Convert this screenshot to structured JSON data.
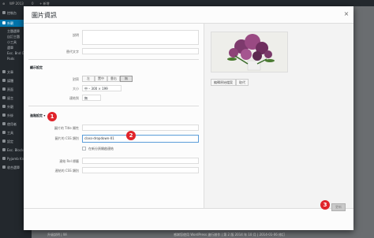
{
  "adminbar": {
    "site": "WP 2013",
    "notifications": "0",
    "new_label": "+ 新增"
  },
  "sidebar": {
    "items": [
      {
        "label": "控制台",
        "active": false
      },
      {
        "label": "外觀",
        "active": true
      },
      {
        "label": "文章",
        "active": false
      },
      {
        "label": "媒體",
        "active": false
      },
      {
        "label": "頁面",
        "active": false
      },
      {
        "label": "留言",
        "active": false
      },
      {
        "label": "外觀",
        "active": false
      },
      {
        "label": "外掛",
        "active": false
      },
      {
        "label": "使用者",
        "active": false
      },
      {
        "label": "工具",
        "active": false
      },
      {
        "label": "設定",
        "active": false
      },
      {
        "label": "Exc. Blocks",
        "active": false
      },
      {
        "label": "Pyjamb Knives",
        "active": false
      },
      {
        "label": "收合選單",
        "active": false
      }
    ],
    "subitems": [
      "主題選單",
      "自訂主題",
      "小工具",
      "選單",
      "Exc. Bnd Gallery",
      "Pods"
    ]
  },
  "modal": {
    "title": "圖片資訊",
    "close_glyph": "×",
    "fields": {
      "caption_label": "說明",
      "alt_label": "替代文字"
    },
    "display_settings": {
      "title": "顯示設定",
      "align_label": "對齊",
      "align_options": [
        "左",
        "置中",
        "靠右",
        "無"
      ],
      "align_selected": "無",
      "size_label": "大小",
      "size_value": "中 – 300 × 199",
      "link_label": "連結到",
      "link_value": "無"
    },
    "advanced": {
      "title": "進階設定",
      "toggle_glyph": "▾",
      "title_attr_label": "圖片的 Title 屬性",
      "css_class_label": "圖片的 CSS 類別",
      "css_class_value": "class-dropdown-01",
      "new_tab_label": "在新分頁開啟連結",
      "rel_label": "連結 Rel 標籤",
      "link_css_label": "連結的 CSS 類別"
    },
    "preview": {
      "edit_original_label": "編輯原始檔案",
      "replace_label": "取代"
    },
    "update_label": "更新"
  },
  "callouts": [
    "1",
    "2",
    "3"
  ],
  "footer": {
    "left": "升級說明 | Wi",
    "right": "感謝您使用 WordPress 進行創作 | 第 2 版 2014 年 10 月 | 2014-01-06 修訂"
  },
  "colors": {
    "accent": "#0073aa",
    "callout": "#e0242b",
    "admin_dark": "#23282d"
  }
}
